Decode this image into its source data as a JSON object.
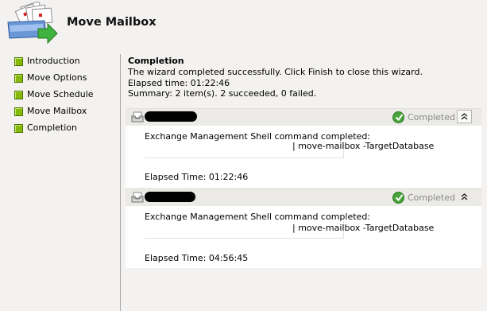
{
  "header": {
    "title": "Move Mailbox",
    "icon": "move-mailbox-icon"
  },
  "nav": {
    "items": [
      {
        "label": "Introduction"
      },
      {
        "label": "Move Options"
      },
      {
        "label": "Move Schedule"
      },
      {
        "label": "Move Mailbox"
      },
      {
        "label": "Completion"
      }
    ],
    "bullet_color": "#86b80a"
  },
  "summary": {
    "title": "Completion",
    "message": "The wizard completed successfully. Click Finish to close this wizard.",
    "elapsed": "Elapsed time: 01:22:46",
    "result": "Summary: 2 item(s). 2 succeeded, 0 failed."
  },
  "items": [
    {
      "status": "Completed",
      "message": "Exchange Management Shell command completed:",
      "command": "| move-mailbox -TargetDatabase",
      "elapsed": "Elapsed Time: 01:22:46"
    },
    {
      "status": "Completed",
      "message": "Exchange Management Shell command completed:",
      "command": "| move-mailbox -TargetDatabase",
      "elapsed": "Elapsed Time: 04:56:45"
    }
  ],
  "colors": {
    "status_green": "#48a33a",
    "background": "#f3f2f0"
  }
}
